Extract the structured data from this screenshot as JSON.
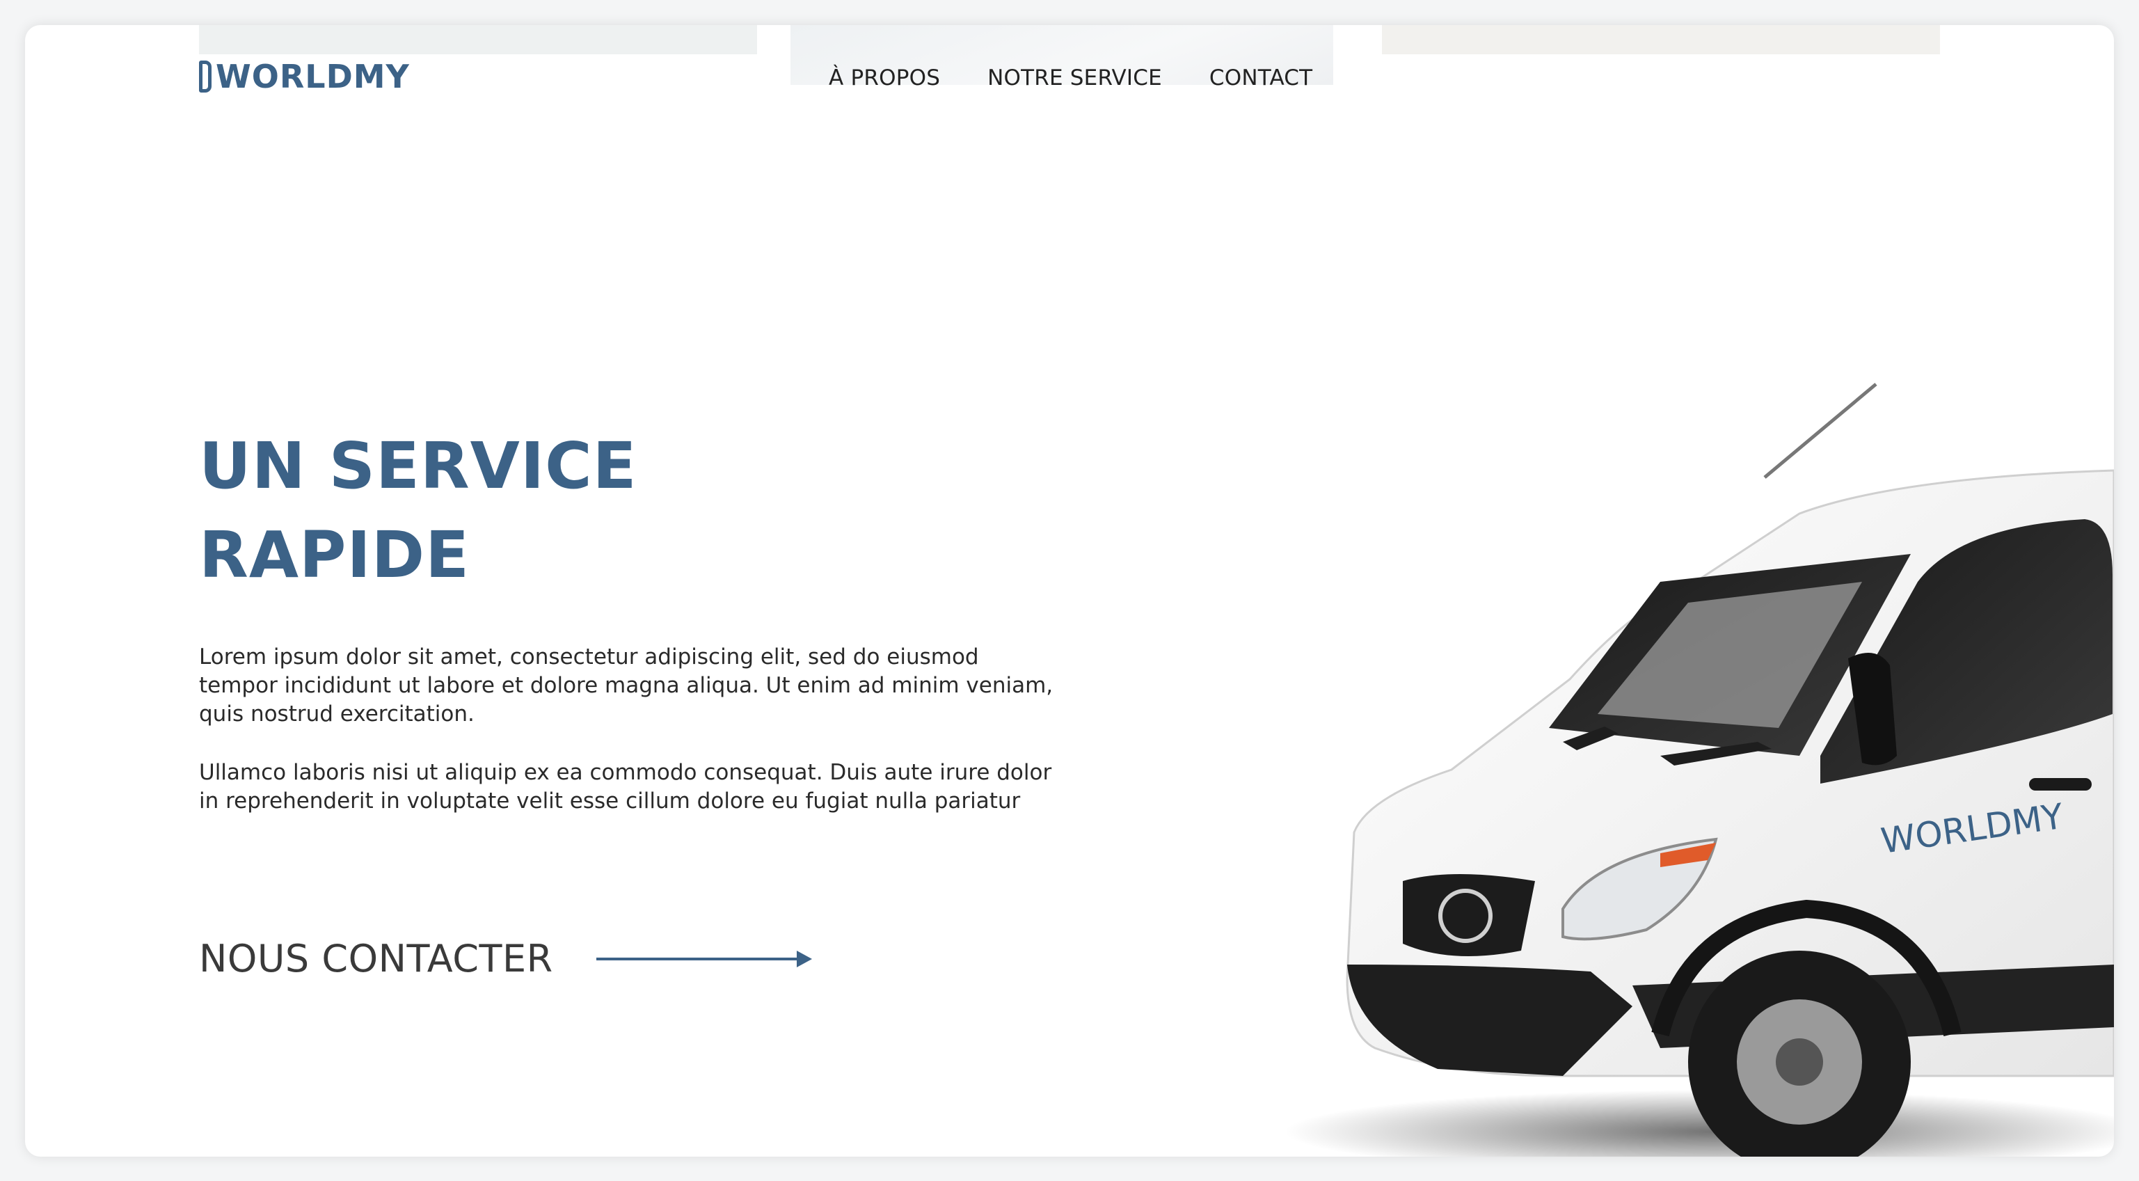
{
  "brand": {
    "logo_text": "WORLDMY",
    "primary_color": "#3c6287"
  },
  "nav": {
    "items": [
      {
        "label": "À PROPOS"
      },
      {
        "label": "NOTRE SERVICE"
      },
      {
        "label": "CONTACT"
      }
    ]
  },
  "hero": {
    "title_line1": "UN SERVICE",
    "title_line2": "RAPIDE",
    "paragraph1": "Lorem ipsum dolor sit amet, consectetur adipiscing elit, sed do eiusmod tempor incididunt ut labore et dolore magna aliqua. Ut enim ad minim veniam, quis nostrud exercitation.",
    "paragraph2": "Ullamco laboris nisi ut aliquip ex ea commodo consequat. Duis aute irure dolor in reprehenderit in voluptate velit esse cillum dolore eu fugiat nulla pariatur",
    "cta_label": "NOUS CONTACTER",
    "cta_icon": "arrow-right-icon"
  },
  "van": {
    "icon": "delivery-van-image",
    "side_logo_text": "WORLDMY"
  }
}
